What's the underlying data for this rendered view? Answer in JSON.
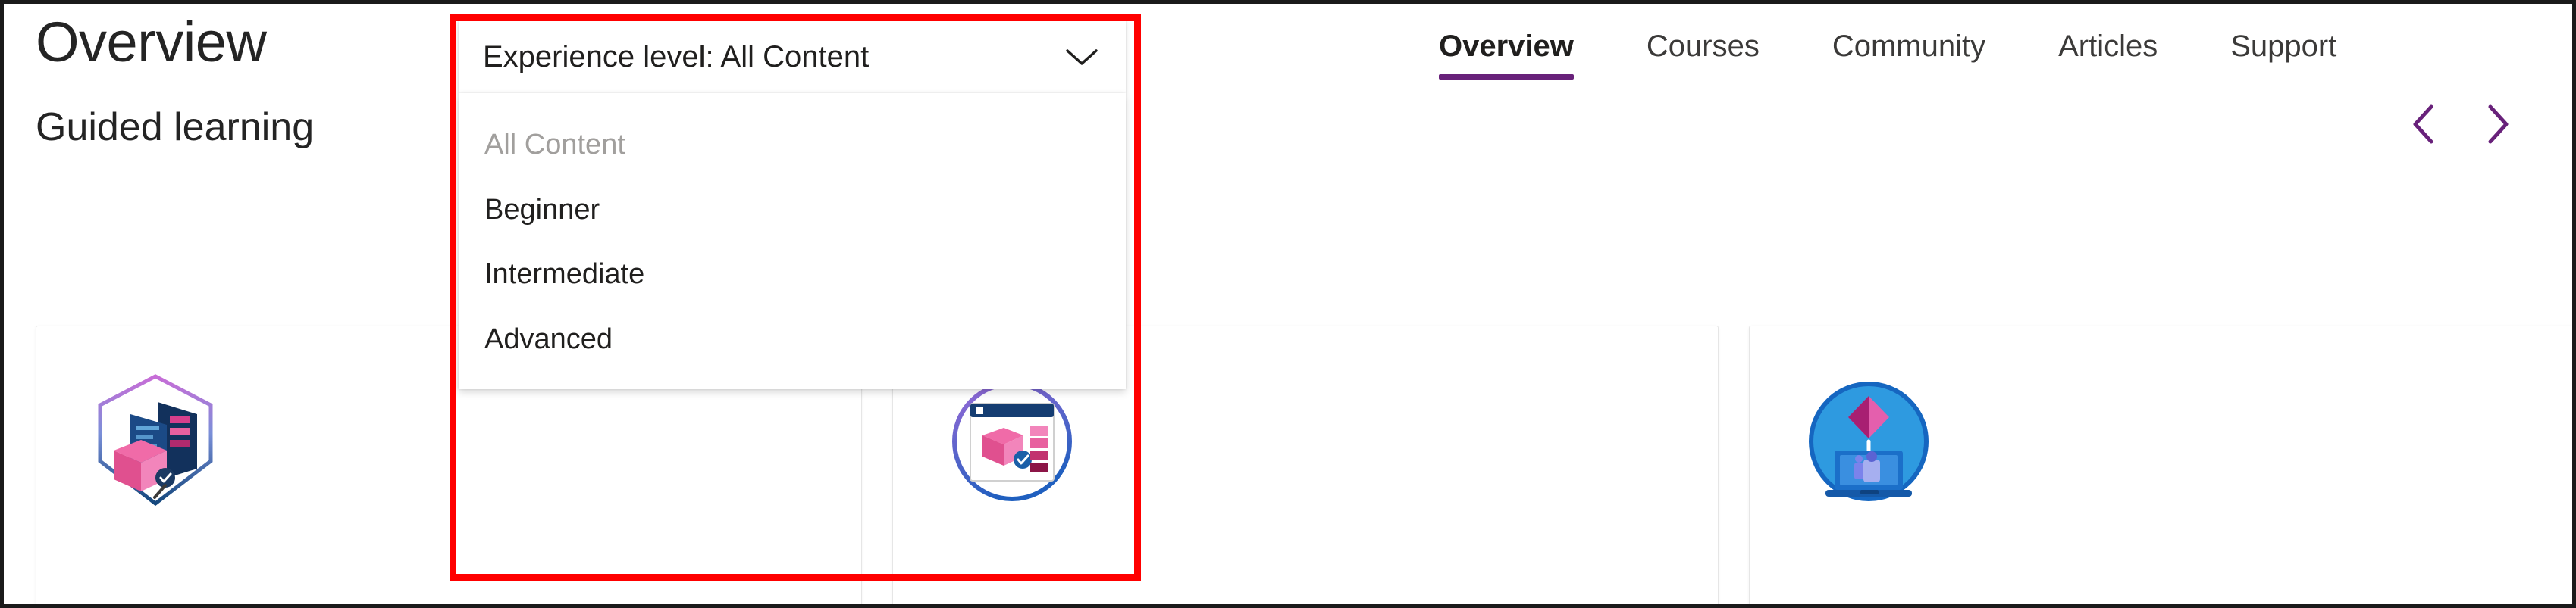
{
  "page": {
    "title": "Overview",
    "section_heading": "Guided learning"
  },
  "nav": {
    "items": [
      {
        "label": "Overview",
        "active": true
      },
      {
        "label": "Courses",
        "active": false
      },
      {
        "label": "Community",
        "active": false
      },
      {
        "label": "Articles",
        "active": false
      },
      {
        "label": "Support",
        "active": false
      }
    ],
    "active_underline_color": "#68217a"
  },
  "carousel": {
    "prev_icon": "chevron-left-icon",
    "next_icon": "chevron-right-icon",
    "arrow_color": "#68217a"
  },
  "experience_filter": {
    "trigger_label": "Experience level: All Content",
    "chevron_icon": "chevron-down-icon",
    "expanded": true,
    "options": [
      {
        "label": "All Content",
        "selected": true
      },
      {
        "label": "Beginner",
        "selected": false
      },
      {
        "label": "Intermediate",
        "selected": false
      },
      {
        "label": "Advanced",
        "selected": false
      }
    ]
  },
  "cards": [
    {
      "icon": "hexagon-badge-data-model-icon"
    },
    {
      "icon": "circle-badge-report-window-icon"
    },
    {
      "icon": "circle-badge-powerbi-teams-laptop-icon"
    }
  ],
  "annotation": {
    "highlight_color": "#ff0000",
    "target": "experience-level-dropdown"
  }
}
